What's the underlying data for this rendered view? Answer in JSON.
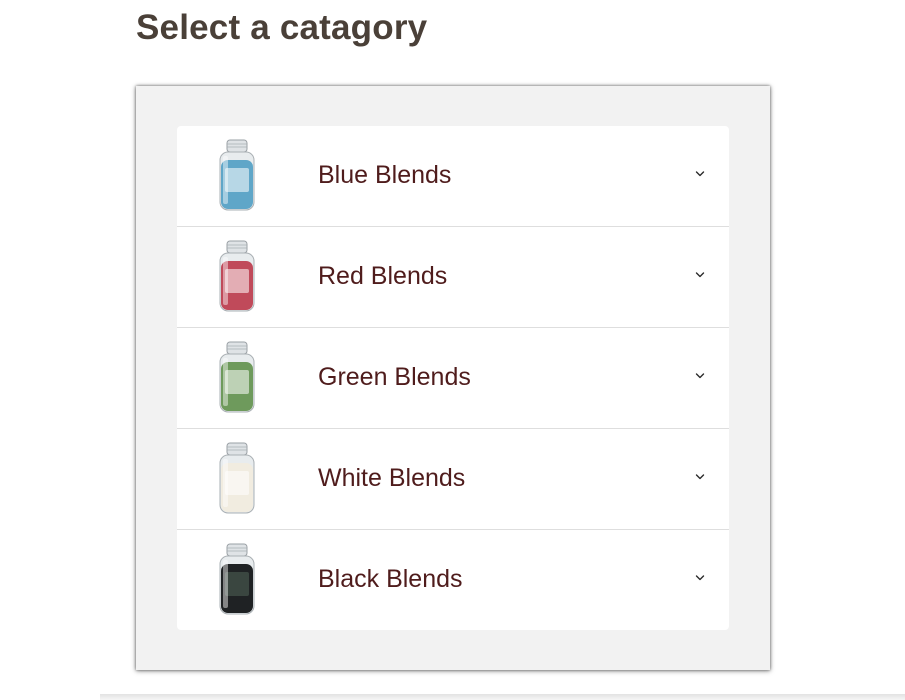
{
  "page": {
    "title": "Select a catagory"
  },
  "categories": [
    {
      "label": "Blue Blends",
      "icon": "candle-jar-blue-icon",
      "color": "#5fa6c8",
      "lid": "#d9dde0"
    },
    {
      "label": "Red Blends",
      "icon": "candle-jar-red-icon",
      "color": "#c04a5a",
      "lid": "#d9dde0"
    },
    {
      "label": "Green Blends",
      "icon": "candle-jar-green-icon",
      "color": "#6e9a5c",
      "lid": "#d9dde0"
    },
    {
      "label": "White Blends",
      "icon": "candle-jar-white-icon",
      "color": "#f1ece0",
      "lid": "#d9dde0"
    },
    {
      "label": "Black Blends",
      "icon": "candle-jar-black-icon",
      "color": "#1f2224",
      "lid": "#d9dde0"
    }
  ],
  "colors": {
    "title": "#4a4038",
    "label": "#4f1c1c",
    "panel": "#f2f2f2"
  }
}
